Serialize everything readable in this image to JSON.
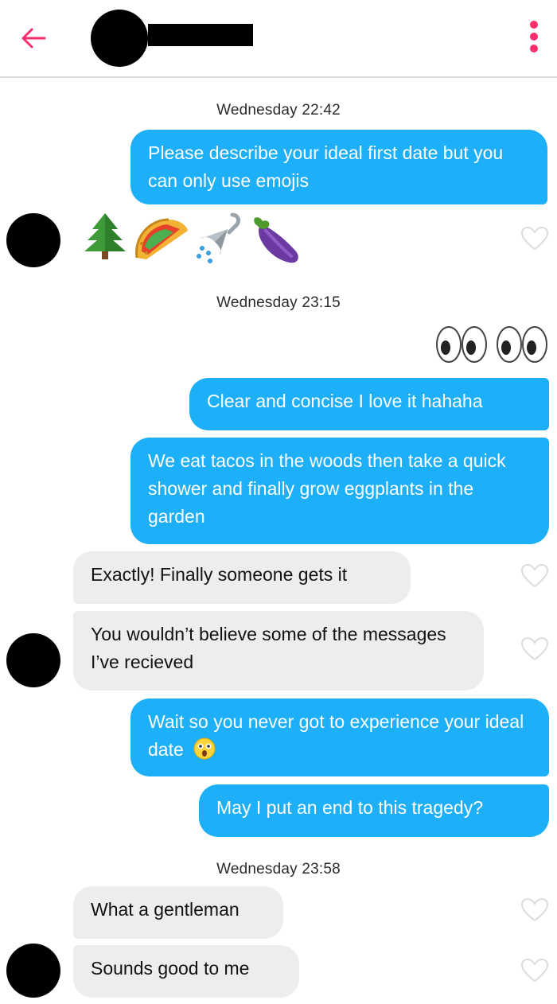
{
  "header": {
    "back_icon": "back-arrow-icon",
    "menu_icon": "more-vertical-icon",
    "accent_color": "#fc2e6a"
  },
  "timestamps": [
    "Wednesday 22:42",
    "Wednesday 23:15",
    "Wednesday 23:58"
  ],
  "messages": {
    "m1": "Please describe your ideal first date but you can only use emojis",
    "emoji_reply": [
      "evergreen-tree-emoji",
      "taco-emoji",
      "shower-emoji",
      "eggplant-emoji"
    ],
    "eyes_reply": [
      "eyes-emoji",
      "eyes-emoji"
    ],
    "m2": "Clear and concise I love it hahaha",
    "m3": "We eat tacos in the woods then take a quick shower and finally grow eggplants in the garden",
    "m4": "Exactly! Finally someone gets it",
    "m5": "You wouldn’t believe some of the messages I’ve recieved",
    "m6": "Wait so you never got to experience your ideal date",
    "m6_emoji": "astonished-face-emoji",
    "m7": "May I put an end to this tragedy?",
    "m8": "What a gentleman",
    "m9": "Sounds good to me"
  },
  "colors": {
    "outgoing": "#1daff7",
    "incoming": "#ededed"
  }
}
